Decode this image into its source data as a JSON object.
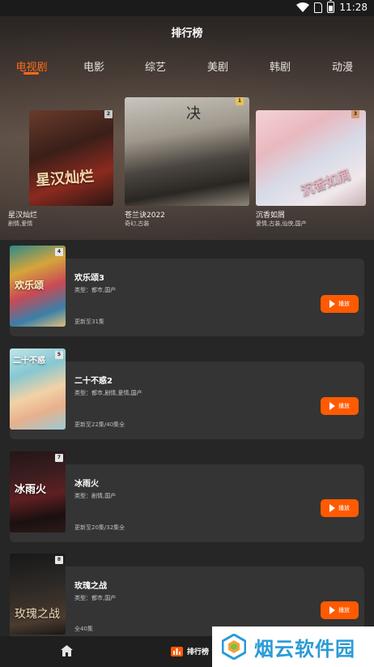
{
  "status_bar": {
    "time": "11:28"
  },
  "header": {
    "title": "排行榜"
  },
  "tabs": [
    {
      "label": "电视剧",
      "active": true
    },
    {
      "label": "电影",
      "active": false
    },
    {
      "label": "综艺",
      "active": false
    },
    {
      "label": "美剧",
      "active": false
    },
    {
      "label": "韩剧",
      "active": false
    },
    {
      "label": "动漫",
      "active": false
    }
  ],
  "podium": [
    {
      "rank": "2",
      "title": "星汉灿烂",
      "tags": "剧情,爱情",
      "poster_text": "星汉灿烂",
      "badge_color": "#c9c9c9"
    },
    {
      "rank": "1",
      "title": "苍兰诀2022",
      "tags": "奇幻,古装",
      "poster_text": "决",
      "badge_color": "#e8c15a"
    },
    {
      "rank": "3",
      "title": "沉香如屑",
      "tags": "爱情,古装,仙侠,国产",
      "poster_text": "沉香如屑",
      "badge_color": "#d79a6a"
    }
  ],
  "list": [
    {
      "rank": "4",
      "title": "欢乐颂3",
      "meta": "类型：都市,国产",
      "status": "更新至31集",
      "poster_text": "欢乐颂",
      "play_label": "播放"
    },
    {
      "rank": "5",
      "title": "二十不惑2",
      "meta": "类型：都市,剧情,爱情,国产",
      "status": "更新至22集/40集全",
      "poster_text": "二十不惑",
      "play_label": "播放"
    },
    {
      "rank": "7",
      "title": "冰雨火",
      "meta": "类型：剧情,国产",
      "status": "更新至20集/32集全",
      "poster_text": "冰雨火",
      "play_label": "播放"
    },
    {
      "rank": "8",
      "title": "玫瑰之战",
      "meta": "类型：都市,国产",
      "status": "全40集",
      "poster_text": "玫瑰之战",
      "play_label": "播放"
    }
  ],
  "bottom_nav": {
    "home_icon": "home-icon",
    "rank_label": "排行榜"
  },
  "watermark": {
    "text": "烟云软件园"
  },
  "colors": {
    "accent": "#ff6a1a",
    "play": "#ff5a00",
    "card": "#343434",
    "background": "#262626"
  }
}
